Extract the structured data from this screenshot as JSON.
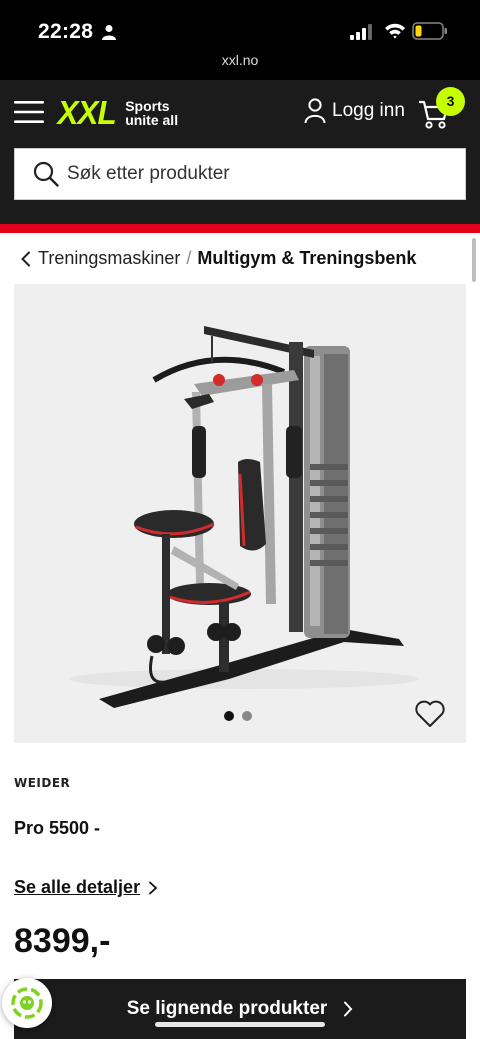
{
  "status_bar": {
    "time": "22:28",
    "url": "xxl.no",
    "icons": [
      "person-icon",
      "signal-icon",
      "wifi-icon",
      "battery-icon"
    ]
  },
  "header": {
    "logo": {
      "mark": "XXL",
      "tagline_1": "Sports",
      "tagline_2": "unite all"
    },
    "login_label": "Logg inn",
    "cart_count": "3",
    "accent_color": "#c5ff00",
    "stripe_color": "#e3001b"
  },
  "search": {
    "placeholder": "Søk etter produkter"
  },
  "breadcrumb": {
    "parent": "Treningsmaskiner",
    "separator": "/",
    "current": "Multigym & Treningsbenk"
  },
  "gallery": {
    "image_count": 2,
    "active_index": 0
  },
  "product": {
    "brand": "WEIDER",
    "name": "Pro 5500 -",
    "details_link": "Se alle detaljer",
    "price": "8399,-"
  },
  "cta": {
    "similar_label": "Se lignende produkter"
  }
}
